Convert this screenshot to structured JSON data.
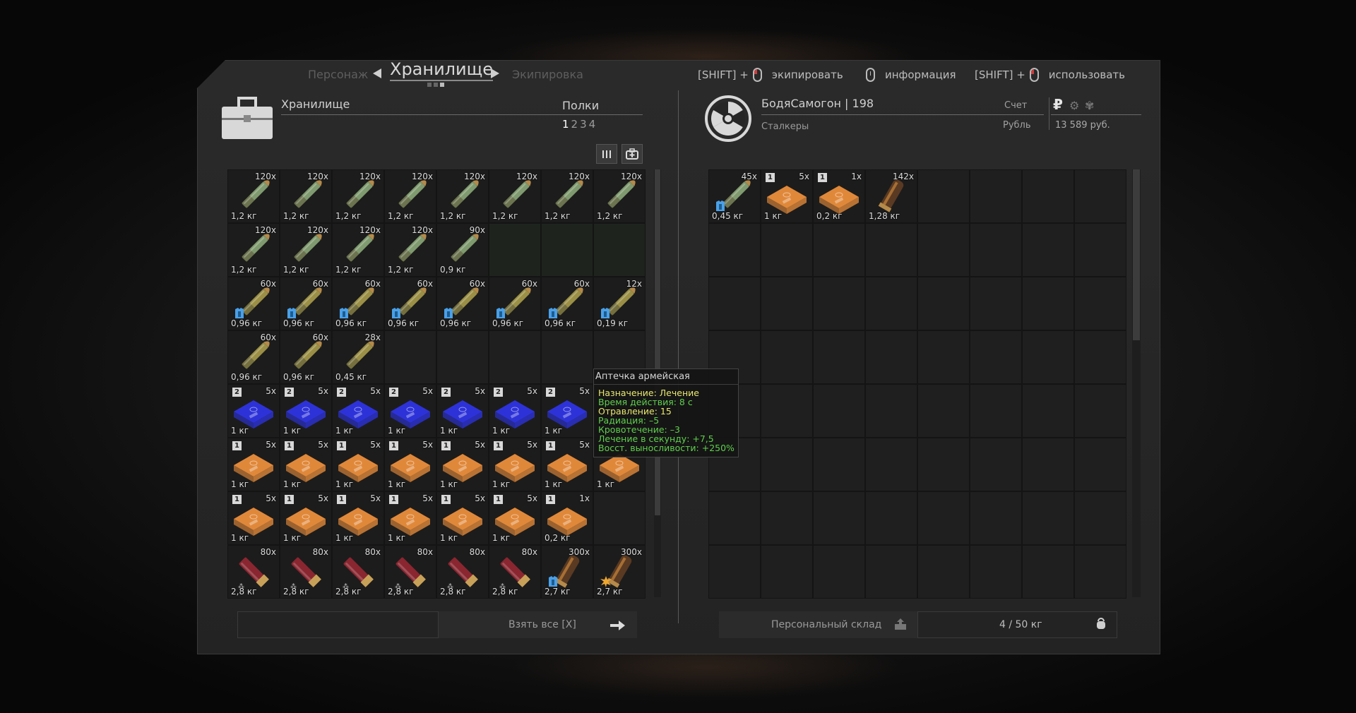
{
  "nav": {
    "prev": "Персонаж",
    "current": "Хранилище",
    "next": "Экипировка"
  },
  "hints": [
    {
      "prefix": "[SHIFT] +",
      "label": "экипировать"
    },
    {
      "prefix": "",
      "label": "информация"
    },
    {
      "prefix": "[SHIFT] +",
      "label": "использовать"
    }
  ],
  "storage": {
    "title": "Хранилище",
    "shelves_label": "Полки",
    "shelves": [
      "1",
      "2",
      "3",
      "4"
    ],
    "active_shelf": 0,
    "take_all": "Взять все [X]"
  },
  "player": {
    "nick": "БодяСамогон",
    "rank": "198",
    "nick_line": "БодяСамогон | 198",
    "faction": "Сталкеры",
    "account_label": "Счет",
    "currency_label": "Рубль",
    "money": "13 589 руб.",
    "personal_storage": "Персональный склад",
    "weight": "4 / 50 кг"
  },
  "colors": {
    "bullet_green": "#7f9a6e",
    "bullet_olive": "#9a8f45",
    "medkit_blue": "#2d32d8",
    "medkit_orange": "#e0883a",
    "shell_red": "#8a2630",
    "tooltip_yellow": "#e8e870",
    "tooltip_green": "#5fd04c"
  },
  "left_grid": [
    {
      "type": "bullet_green",
      "count": "120x",
      "weight": "1,2 кг"
    },
    {
      "type": "bullet_green",
      "count": "120x",
      "weight": "1,2 кг"
    },
    {
      "type": "bullet_green",
      "count": "120x",
      "weight": "1,2 кг"
    },
    {
      "type": "bullet_green",
      "count": "120x",
      "weight": "1,2 кг"
    },
    {
      "type": "bullet_green",
      "count": "120x",
      "weight": "1,2 кг"
    },
    {
      "type": "bullet_green",
      "count": "120x",
      "weight": "1,2 кг"
    },
    {
      "type": "bullet_green",
      "count": "120x",
      "weight": "1,2 кг"
    },
    {
      "type": "bullet_green",
      "count": "120x",
      "weight": "1,2 кг"
    },
    {
      "type": "bullet_green",
      "count": "120x",
      "weight": "1,2 кг"
    },
    {
      "type": "bullet_green",
      "count": "120x",
      "weight": "1,2 кг"
    },
    {
      "type": "bullet_green",
      "count": "120x",
      "weight": "1,2 кг"
    },
    {
      "type": "bullet_green",
      "count": "120x",
      "weight": "1,2 кг"
    },
    {
      "type": "bullet_green",
      "count": "90x",
      "weight": "0,9 кг"
    },
    {
      "type": "empty_green"
    },
    {
      "type": "empty_green"
    },
    {
      "type": "empty_green"
    },
    {
      "type": "bullet_olive",
      "count": "60x",
      "weight": "0,96 кг",
      "armor": true
    },
    {
      "type": "bullet_olive",
      "count": "60x",
      "weight": "0,96 кг",
      "armor": true
    },
    {
      "type": "bullet_olive",
      "count": "60x",
      "weight": "0,96 кг",
      "armor": true
    },
    {
      "type": "bullet_olive",
      "count": "60x",
      "weight": "0,96 кг",
      "armor": true
    },
    {
      "type": "bullet_olive",
      "count": "60x",
      "weight": "0,96 кг",
      "armor": true
    },
    {
      "type": "bullet_olive",
      "count": "60x",
      "weight": "0,96 кг",
      "armor": true
    },
    {
      "type": "bullet_olive",
      "count": "60x",
      "weight": "0,96 кг",
      "armor": true
    },
    {
      "type": "bullet_olive",
      "count": "12x",
      "weight": "0,19 кг",
      "armor": true
    },
    {
      "type": "bullet_olive",
      "count": "60x",
      "weight": "0,96 кг"
    },
    {
      "type": "bullet_olive",
      "count": "60x",
      "weight": "0,96 кг"
    },
    {
      "type": "bullet_olive",
      "count": "28x",
      "weight": "0,45 кг"
    },
    {
      "type": "empty"
    },
    {
      "type": "empty"
    },
    {
      "type": "empty"
    },
    {
      "type": "empty"
    },
    {
      "type": "empty"
    },
    {
      "type": "medkit_blue",
      "count": "5x",
      "weight": "1 кг",
      "level": "2"
    },
    {
      "type": "medkit_blue",
      "count": "5x",
      "weight": "1 кг",
      "level": "2"
    },
    {
      "type": "medkit_blue",
      "count": "5x",
      "weight": "1 кг",
      "level": "2"
    },
    {
      "type": "medkit_blue",
      "count": "5x",
      "weight": "1 кг",
      "level": "2"
    },
    {
      "type": "medkit_blue",
      "count": "5x",
      "weight": "1 кг",
      "level": "2"
    },
    {
      "type": "medkit_blue",
      "count": "5x",
      "weight": "1 кг",
      "level": "2"
    },
    {
      "type": "medkit_blue",
      "count": "5x",
      "weight": "1 кг",
      "level": "2"
    },
    {
      "type": "empty"
    },
    {
      "type": "medkit_orange",
      "count": "5x",
      "weight": "1 кг",
      "level": "1"
    },
    {
      "type": "medkit_orange",
      "count": "5x",
      "weight": "1 кг",
      "level": "1"
    },
    {
      "type": "medkit_orange",
      "count": "5x",
      "weight": "1 кг",
      "level": "1"
    },
    {
      "type": "medkit_orange",
      "count": "5x",
      "weight": "1 кг",
      "level": "1"
    },
    {
      "type": "medkit_orange",
      "count": "5x",
      "weight": "1 кг",
      "level": "1"
    },
    {
      "type": "medkit_orange",
      "count": "5x",
      "weight": "1 кг",
      "level": "1"
    },
    {
      "type": "medkit_orange",
      "count": "5x",
      "weight": "1 кг",
      "level": "1"
    },
    {
      "type": "medkit_orange",
      "count": "",
      "weight": "1 кг",
      "level": ""
    },
    {
      "type": "medkit_orange",
      "count": "5x",
      "weight": "1 кг",
      "level": "1"
    },
    {
      "type": "medkit_orange",
      "count": "5x",
      "weight": "1 кг",
      "level": "1"
    },
    {
      "type": "medkit_orange",
      "count": "5x",
      "weight": "1 кг",
      "level": "1"
    },
    {
      "type": "medkit_orange",
      "count": "5x",
      "weight": "1 кг",
      "level": "1"
    },
    {
      "type": "medkit_orange",
      "count": "5x",
      "weight": "1 кг",
      "level": "1"
    },
    {
      "type": "medkit_orange",
      "count": "5x",
      "weight": "1 кг",
      "level": "1"
    },
    {
      "type": "medkit_orange",
      "count": "1x",
      "weight": "0,2 кг",
      "level": "1"
    },
    {
      "type": "empty"
    },
    {
      "type": "shell_red",
      "count": "80x",
      "weight": "2,8 кг"
    },
    {
      "type": "shell_red",
      "count": "80x",
      "weight": "2,8 кг"
    },
    {
      "type": "shell_red",
      "count": "80x",
      "weight": "2,8 кг"
    },
    {
      "type": "shell_red",
      "count": "80x",
      "weight": "2,8 кг"
    },
    {
      "type": "shell_red",
      "count": "80x",
      "weight": "2,8 кг"
    },
    {
      "type": "shell_red",
      "count": "80x",
      "weight": "2,8 кг"
    },
    {
      "type": "shell_brass",
      "count": "300x",
      "weight": "2,7 кг",
      "armor": true
    },
    {
      "type": "shell_brass",
      "count": "300x",
      "weight": "2,7 кг",
      "fire": true
    }
  ],
  "right_items": [
    {
      "type": "bullet_green",
      "count": "45x",
      "weight": "0,45 кг",
      "armor": true
    },
    {
      "type": "medkit_orange",
      "count": "5x",
      "weight": "1 кг",
      "level": "1"
    },
    {
      "type": "medkit_orange",
      "count": "1x",
      "weight": "0,2 кг",
      "level": "1"
    },
    {
      "type": "shell_brass",
      "count": "142x",
      "weight": "1,28 кг"
    }
  ],
  "tooltip": {
    "title": "Аптечка армейская",
    "purpose": "Назначение: Лечение",
    "lines": [
      "Время действия: 8 с",
      "Отравление: 15",
      "Радиация: –5",
      "Кровотечение: –3",
      "Лечение в секунду: +7,5",
      "Восст. выносливости: +250%"
    ]
  }
}
